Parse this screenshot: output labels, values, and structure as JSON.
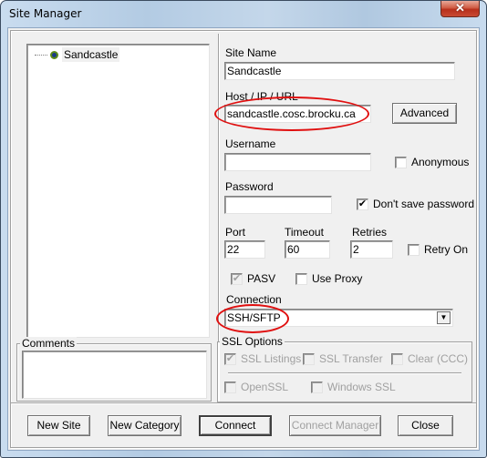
{
  "window": {
    "title": "Site Manager",
    "close_icon": "close-icon"
  },
  "tree": {
    "items": [
      {
        "label": "Sandcastle",
        "icon": "site-icon",
        "selected": true
      }
    ]
  },
  "form": {
    "site_name_label": "Site Name",
    "site_name_value": "Sandcastle",
    "host_label": "Host / IP / URL",
    "host_value": "sandcastle.cosc.brocku.ca",
    "advanced_button": "Advanced",
    "username_label": "Username",
    "username_value": "",
    "anonymous_label": "Anonymous",
    "anonymous_checked": false,
    "password_label": "Password",
    "password_value": "",
    "dont_save_password_label": "Don't save password",
    "dont_save_password_checked": true,
    "port_label": "Port",
    "port_value": "22",
    "timeout_label": "Timeout",
    "timeout_value": "60",
    "retries_label": "Retries",
    "retries_value": "2",
    "retry_on_label": "Retry On",
    "retry_on_checked": false,
    "pasv_label": "PASV",
    "pasv_checked": true,
    "pasv_disabled": true,
    "use_proxy_label": "Use Proxy",
    "use_proxy_checked": false,
    "connection_label": "Connection",
    "connection_value": "SSH/SFTP"
  },
  "comments": {
    "label": "Comments",
    "value": ""
  },
  "ssl_options": {
    "label": "SSL Options",
    "ssl_listings": {
      "label": "SSL Listings",
      "checked": true,
      "disabled": true
    },
    "ssl_transfer": {
      "label": "SSL Transfer",
      "checked": false,
      "disabled": true
    },
    "clear_ccc": {
      "label": "Clear (CCC)",
      "checked": false,
      "disabled": true
    },
    "openssl": {
      "label": "OpenSSL",
      "checked": false,
      "disabled": true
    },
    "windows_ssl": {
      "label": "Windows SSL",
      "checked": false,
      "disabled": true
    }
  },
  "buttons": {
    "new_site": "New Site",
    "new_category": "New Category",
    "connect": "Connect",
    "connect_manager": "Connect Manager",
    "close": "Close"
  },
  "annotations": {
    "highlight_color": "#e01010"
  }
}
